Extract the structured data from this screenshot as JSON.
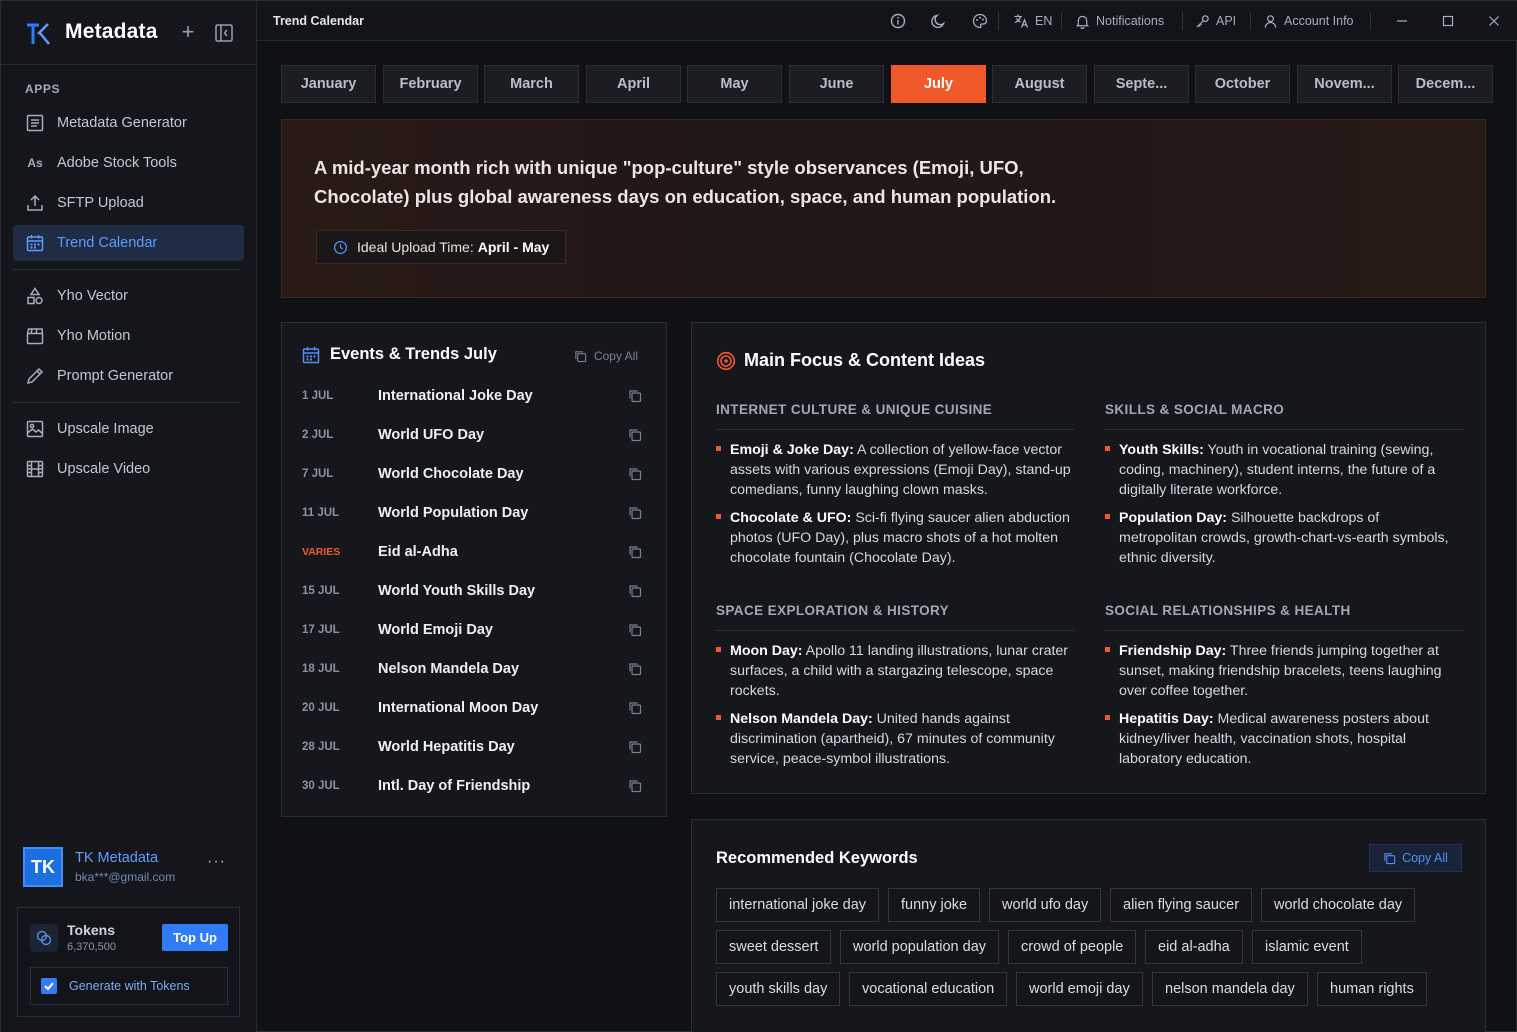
{
  "brand": {
    "name": "Metadata"
  },
  "sidebar": {
    "section_label": "APPS",
    "items": [
      {
        "label": "Metadata Generator",
        "icon": "list-icon"
      },
      {
        "label": "Adobe Stock Tools",
        "icon": "as-icon",
        "icon_text": "As"
      },
      {
        "label": "SFTP Upload",
        "icon": "upload-icon"
      },
      {
        "label": "Trend Calendar",
        "icon": "calendar-icon",
        "active": true
      },
      {
        "label": "Yho Vector",
        "icon": "shapes-icon"
      },
      {
        "label": "Yho Motion",
        "icon": "clapper-icon"
      },
      {
        "label": "Prompt Generator",
        "icon": "pencil-icon"
      },
      {
        "label": "Upscale Image",
        "icon": "image-icon"
      },
      {
        "label": "Upscale Video",
        "icon": "film-icon"
      }
    ]
  },
  "user": {
    "initials": "TK",
    "name": "TK Metadata",
    "email": "bka***@gmail.com",
    "more": "···"
  },
  "tokens": {
    "label": "Tokens",
    "count": "6,370,500",
    "topup_label": "Top Up",
    "generate_label": "Generate with Tokens",
    "generate_checked": true
  },
  "topbar": {
    "title": "Trend Calendar",
    "language": "EN",
    "notifications": "Notifications",
    "api": "API",
    "account": "Account Info"
  },
  "months": [
    "January",
    "February",
    "March",
    "April",
    "May",
    "June",
    "July",
    "August",
    "Septe...",
    "October",
    "Novem...",
    "Decem..."
  ],
  "active_month": "July",
  "hero": {
    "description": "A mid-year month rich with unique \"pop-culture\" style observances (Emoji, UFO, Chocolate) plus global awareness days on education, space, and human population.",
    "upload_label": "Ideal Upload Time:",
    "upload_value": "April - May"
  },
  "events": {
    "title": "Events & Trends July",
    "copy_all": "Copy All",
    "items": [
      {
        "date": "1 JUL",
        "name": "International Joke Day"
      },
      {
        "date": "2 JUL",
        "name": "World UFO Day"
      },
      {
        "date": "7 JUL",
        "name": "World Chocolate Day"
      },
      {
        "date": "11 JUL",
        "name": "World Population Day"
      },
      {
        "date": "VARIES",
        "name": "Eid al-Adha"
      },
      {
        "date": "15 JUL",
        "name": "World Youth Skills Day"
      },
      {
        "date": "17 JUL",
        "name": "World Emoji Day"
      },
      {
        "date": "18 JUL",
        "name": "Nelson Mandela Day"
      },
      {
        "date": "20 JUL",
        "name": "International Moon Day"
      },
      {
        "date": "28 JUL",
        "name": "World Hepatitis Day"
      },
      {
        "date": "30 JUL",
        "name": "Intl. Day of Friendship"
      }
    ]
  },
  "focus": {
    "title": "Main Focus & Content Ideas",
    "sections": [
      {
        "title": "INTERNET CULTURE & UNIQUE CUISINE",
        "bullets": [
          {
            "lead": "Emoji & Joke Day:",
            "text": " A collection of yellow-face vector assets with various expressions (Emoji Day), stand-up comedians, funny laughing clown masks."
          },
          {
            "lead": "Chocolate & UFO:",
            "text": " Sci-fi flying saucer alien abduction photos (UFO Day), plus macro shots of a hot molten chocolate fountain (Chocolate Day)."
          }
        ]
      },
      {
        "title": "SKILLS & SOCIAL MACRO",
        "bullets": [
          {
            "lead": "Youth Skills:",
            "text": " Youth in vocational training (sewing, coding, machinery), student interns, the future of a digitally literate workforce."
          },
          {
            "lead": "Population Day:",
            "text": " Silhouette backdrops of metropolitan crowds, growth-chart-vs-earth symbols, ethnic diversity."
          }
        ]
      },
      {
        "title": "SPACE EXPLORATION & HISTORY",
        "bullets": [
          {
            "lead": "Moon Day:",
            "text": " Apollo 11 landing illustrations, lunar crater surfaces, a child with a stargazing telescope, space rockets."
          },
          {
            "lead": "Nelson Mandela Day:",
            "text": " United hands against discrimination (apartheid), 67 minutes of community service, peace-symbol illustrations."
          }
        ]
      },
      {
        "title": "SOCIAL RELATIONSHIPS & HEALTH",
        "bullets": [
          {
            "lead": "Friendship Day:",
            "text": " Three friends jumping together at sunset, making friendship bracelets, teens laughing over coffee together."
          },
          {
            "lead": "Hepatitis Day:",
            "text": " Medical awareness posters about kidney/liver health, vaccination shots, hospital laboratory education."
          }
        ]
      }
    ]
  },
  "keywords": {
    "title": "Recommended Keywords",
    "copy_all": "Copy All",
    "rows": [
      [
        "international joke day",
        "funny joke",
        "world ufo day",
        "alien flying saucer",
        "world chocolate day"
      ],
      [
        "sweet dessert",
        "world population day",
        "crowd of people",
        "eid al-adha",
        "islamic event"
      ],
      [
        "youth skills day",
        "vocational education",
        "world emoji day",
        "nelson mandela day",
        "human rights"
      ]
    ]
  },
  "colors": {
    "accent": "#f0592a",
    "primary": "#2f7cf6",
    "background": "#0f1115"
  }
}
